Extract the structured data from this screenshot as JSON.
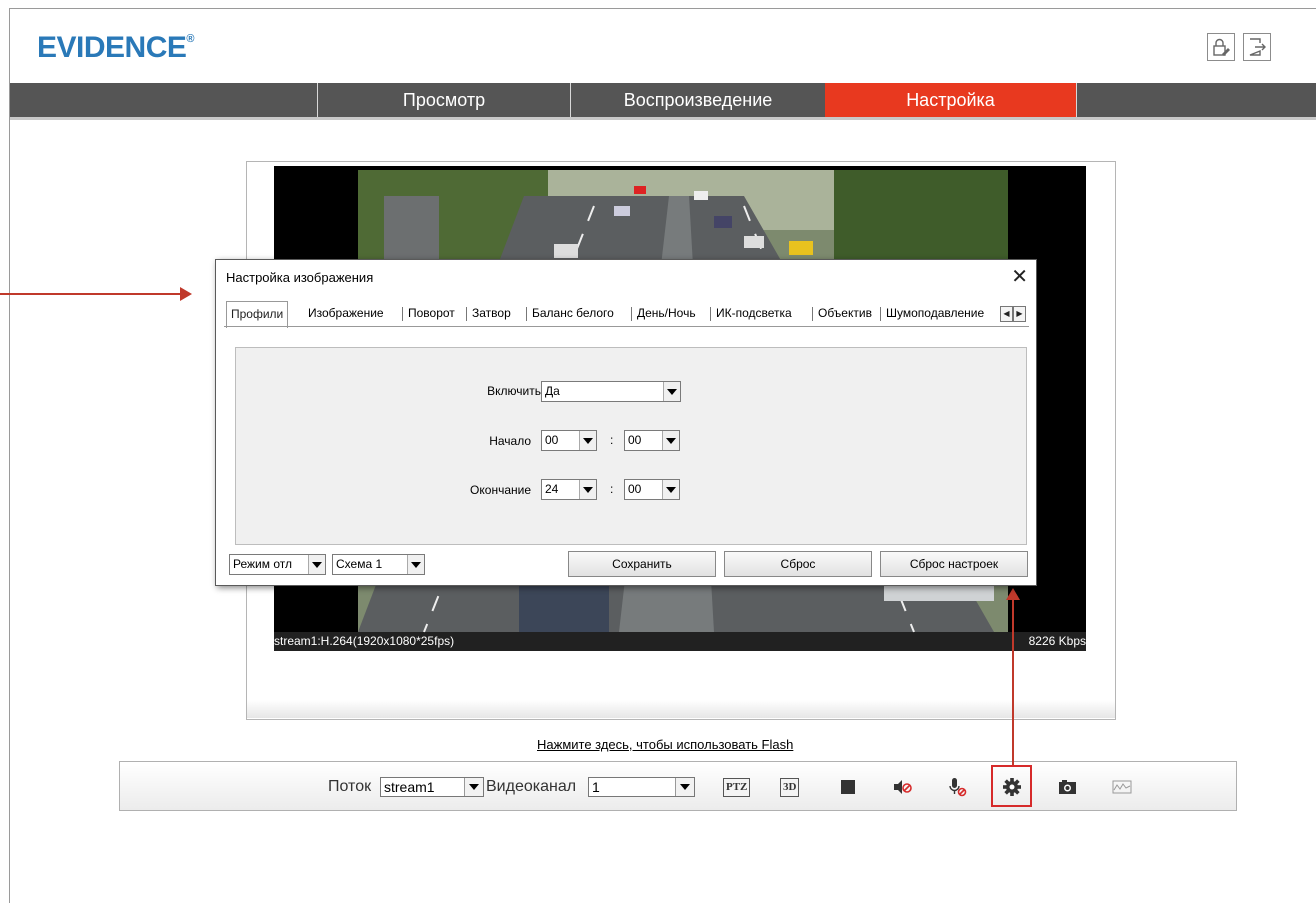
{
  "header": {
    "logo_text": "EVIDENCE",
    "logo_mark": "®",
    "lock_button_icon": "lock-edit-icon",
    "logout_button_icon": "logout-icon"
  },
  "nav": {
    "tabs": [
      {
        "label": "Просмотр",
        "active": false
      },
      {
        "label": "Воспроизведение",
        "active": false
      },
      {
        "label": "Настройка",
        "active": true
      }
    ]
  },
  "video": {
    "status_left": "stream1:H.264(1920x1080*25fps)",
    "status_right": "8226 Kbps"
  },
  "flash_link": "Нажмите здесь, чтобы использовать Flash",
  "toolbar": {
    "stream_label": "Поток",
    "stream_value": "stream1",
    "channel_label": "Видеоканал",
    "channel_value": "1",
    "ptz_label": "PTZ",
    "three_d_label": "3D"
  },
  "dialog": {
    "title": "Настройка изображения",
    "tabs": [
      "Профили",
      "Изображение",
      "Поворот",
      "Затвор",
      "Баланс белого",
      "День/Ночь",
      "ИК-подсветка",
      "Объектив",
      "Шумоподавление"
    ],
    "active_tab": "Профили",
    "form": {
      "enable_label": "Включить",
      "enable_value": "Да",
      "start_label": "Начало",
      "start_hour": "00",
      "start_min": "00",
      "end_label": "Окончание",
      "end_hour": "24",
      "end_min": "00",
      "colon": ":"
    },
    "bottom": {
      "mode_value": "Режим отл",
      "scheme_value": "Схема 1",
      "save_label": "Сохранить",
      "reset_label": "Сброс",
      "factory_reset_label": "Сброс настроек"
    }
  },
  "colors": {
    "brand": "#2a79b8",
    "nav_bg": "#555555",
    "nav_active": "#e8391f",
    "annotation": "#c0392b"
  }
}
